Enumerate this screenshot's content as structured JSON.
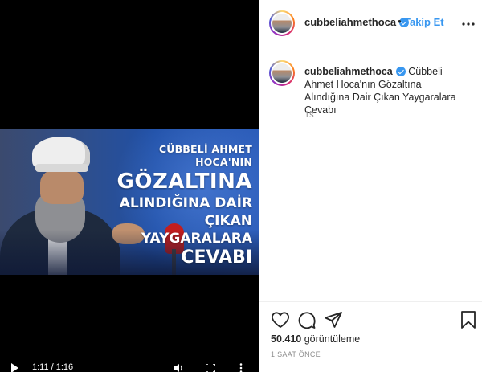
{
  "video": {
    "headline": {
      "line1": "CÜBBELİ AHMET HOCA'NIN",
      "line2": "GÖZALTINA",
      "line3": "ALINDIĞINA DAİR",
      "line4": "ÇIKAN YAYGARALARA",
      "line5": "CEVABI"
    },
    "time": "1:11 / 1:16"
  },
  "header": {
    "username": "cubbeliahmethoca",
    "separator": "•",
    "follow_label": "Takip Et"
  },
  "caption": {
    "username": "cubbeliahmethoca",
    "text": "Cübbeli Ahmet Hoca'nın Gözaltına Alındığına Dair Çıkan Yaygaralara Cevabı",
    "time": "1s"
  },
  "stats": {
    "views_count": "50.410",
    "views_label": "görüntüleme",
    "posted_ago": "1 SAAT ÖNCE"
  },
  "colors": {
    "accent": "#3897f0",
    "text": "#262626",
    "muted": "#8e8e8e",
    "border": "#efefef"
  }
}
